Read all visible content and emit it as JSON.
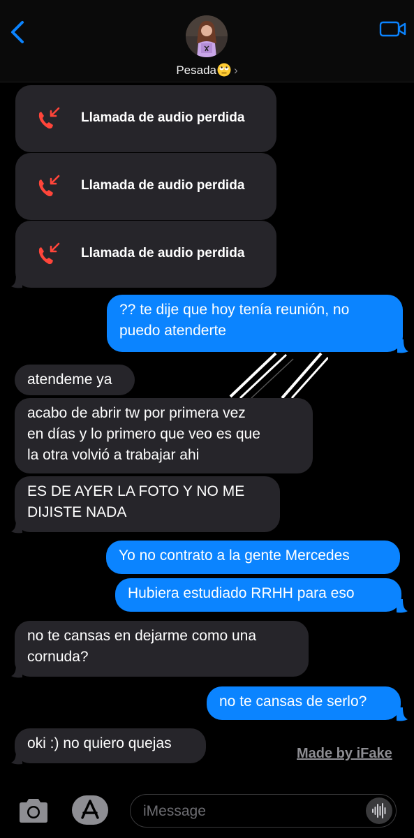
{
  "header": {
    "contact_name": "Pesada",
    "contact_emoji": "eye-roll-emoji",
    "back_icon": "chevron-left-icon",
    "video_icon": "video-camera-icon",
    "accent_color": "#0b84ff"
  },
  "messages": [
    {
      "type": "missed-call",
      "side": "in",
      "label": "Llamada de audio perdida"
    },
    {
      "type": "missed-call",
      "side": "in",
      "label": "Llamada de audio perdida"
    },
    {
      "type": "missed-call",
      "side": "in",
      "label": "Llamada de audio perdida"
    },
    {
      "type": "text",
      "side": "out",
      "lines": [
        "?? te dije que hoy tenía reunión, no",
        "puedo atenderte"
      ]
    },
    {
      "type": "text",
      "side": "in",
      "lines": [
        "atendeme ya"
      ]
    },
    {
      "type": "text",
      "side": "in",
      "lines": [
        "acabo de abrir tw por primera vez",
        "en días y lo primero que veo es que",
        "la otra volvió a trabajar ahi"
      ]
    },
    {
      "type": "text",
      "side": "in",
      "lines": [
        "ES DE AYER LA FOTO Y NO ME",
        "DIJISTE NADA"
      ]
    },
    {
      "type": "text",
      "side": "out",
      "lines": [
        "Yo no contrato a la gente Mercedes"
      ]
    },
    {
      "type": "text",
      "side": "out",
      "lines": [
        "Hubiera estudiado RRHH para eso"
      ]
    },
    {
      "type": "text",
      "side": "in",
      "lines": [
        "no te cansas en dejarme como una",
        "cornuda?"
      ]
    },
    {
      "type": "text",
      "side": "out",
      "lines": [
        "no te cansas de serlo?"
      ]
    },
    {
      "type": "text",
      "side": "in",
      "lines": [
        "oki :) no quiero quejas"
      ]
    }
  ],
  "watermark": "Made by iFake",
  "input_bar": {
    "placeholder": "iMessage",
    "camera_icon": "camera-icon",
    "apps_icon": "app-store-icon",
    "audio_icon": "waveform-icon"
  },
  "colors": {
    "incoming_bubble": "#26252a",
    "outgoing_bubble": "#0b84ff",
    "missed_call_icon": "#ff453a",
    "background": "#000000"
  }
}
